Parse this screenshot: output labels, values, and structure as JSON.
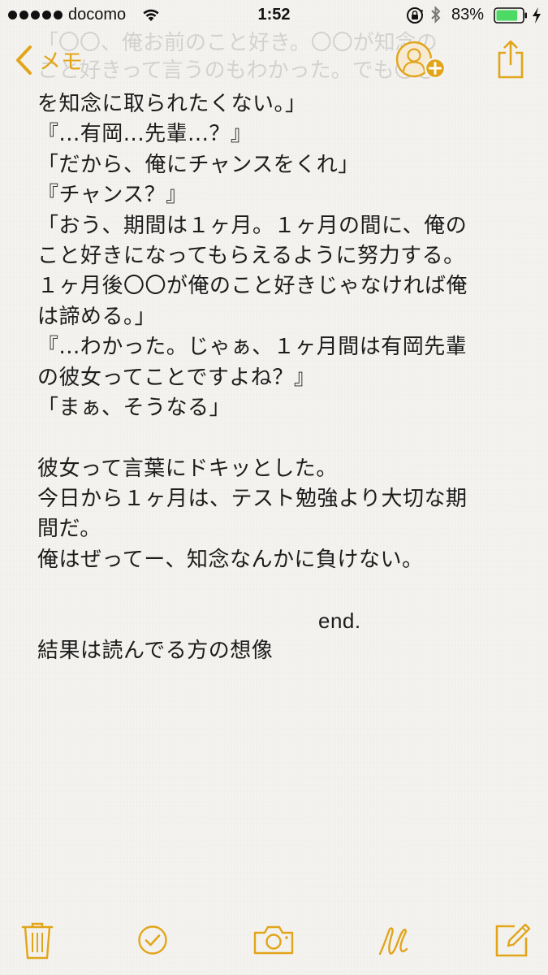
{
  "status_bar": {
    "carrier": "docomo",
    "time": "1:52",
    "battery_percent": "83%",
    "battery_level": 0.83
  },
  "faded_text": "「〇〇、俺お前のこと好き。〇〇が知念の\nこと好きって言うのもわかった。でも〇〇",
  "nav": {
    "back_label": "メモ"
  },
  "note": {
    "lines": [
      "を知念に取られたくない。」",
      "『...有岡...先輩...？』",
      "「だから、俺にチャンスをくれ」",
      "『チャンス？』",
      "「おう、期間は１ヶ月。１ヶ月の間に、俺の",
      "こと好きになってもらえるように努力する。",
      "１ヶ月後〇〇が俺のこと好きじゃなければ俺",
      "は諦める。」",
      "『...わかった。じゃぁ、１ヶ月間は有岡先輩",
      "の彼女ってことですよね？』",
      "「まぁ、そうなる」",
      "",
      "彼女って言葉にドキッとした。",
      "今日から１ヶ月は、テスト勉強より大切な期",
      "間だ。",
      "俺はぜってー、知念なんかに負けない。",
      "",
      "end.",
      "結果は読んでる方の想像"
    ]
  },
  "toolbar": {
    "icons": [
      "trash-icon",
      "checklist-icon",
      "camera-icon",
      "sketch-icon",
      "compose-icon"
    ]
  },
  "colors": {
    "accent": "#e2a51a",
    "battery_fill": "#4cd964",
    "background": "#f4f3f0"
  }
}
